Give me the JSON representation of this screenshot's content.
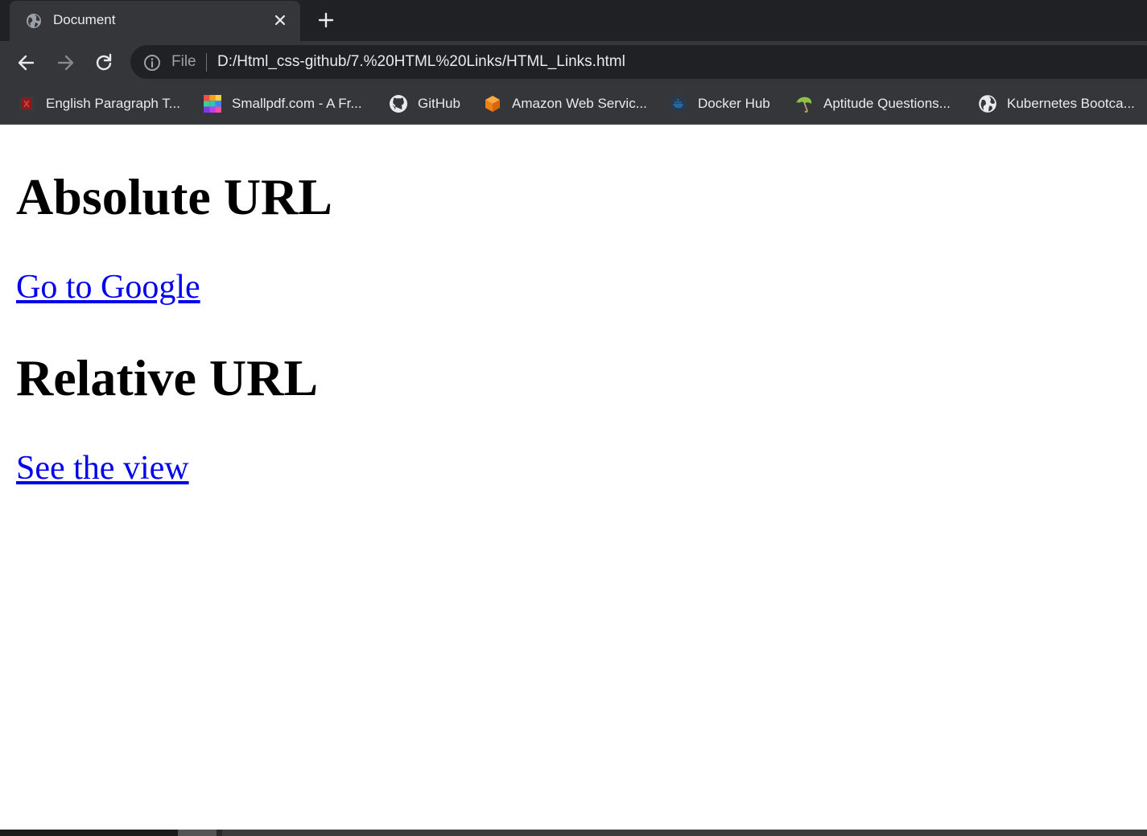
{
  "browser": {
    "tab": {
      "title": "Document",
      "favicon": "globe-icon"
    },
    "new_tab_icon": "plus-icon",
    "toolbar": {
      "back_icon": "arrow-left-icon",
      "forward_icon": "arrow-right-icon",
      "reload_icon": "reload-icon",
      "scheme_label": "File",
      "url": "D:/Html_css-github/7.%20HTML%20Links/HTML_Links.html"
    },
    "bookmarks": [
      {
        "label": "English Paragraph T...",
        "icon": "book-icon"
      },
      {
        "label": "Smallpdf.com - A Fr...",
        "icon": "smallpdf-icon"
      },
      {
        "label": "GitHub",
        "icon": "github-icon"
      },
      {
        "label": "Amazon Web Servic...",
        "icon": "aws-cube-icon"
      },
      {
        "label": "Docker Hub",
        "icon": "docker-icon"
      },
      {
        "label": "Aptitude Questions...",
        "icon": "umbrella-icon"
      },
      {
        "label": "Kubernetes Bootca...",
        "icon": "globe-icon"
      }
    ]
  },
  "page": {
    "heading_absolute": "Absolute URL",
    "link_absolute": "Go to Google",
    "heading_relative": "Relative URL",
    "link_relative": "See the view"
  },
  "colors": {
    "chrome_dark": "#202124",
    "chrome_toolbar": "#35363a",
    "chrome_text": "#e8eaed",
    "link": "#0000ee",
    "heading": "#000000"
  }
}
